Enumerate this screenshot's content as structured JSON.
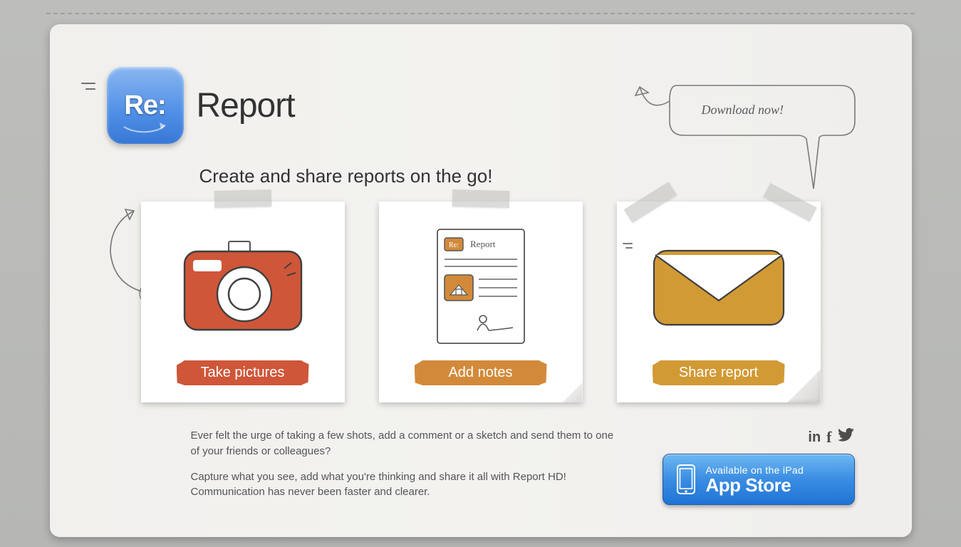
{
  "brand": {
    "icon_text": "Re:",
    "title": "Report"
  },
  "tagline": "Create and share reports on the go!",
  "download_callout": "Download now!",
  "cards": [
    {
      "label": "Take pictures"
    },
    {
      "label": "Add notes",
      "doc_title": "Report",
      "doc_badge": "Re:"
    },
    {
      "label": "Share report"
    }
  ],
  "blurb": {
    "p1": "Ever felt the urge of taking a few shots, add a comment or a sketch and send them to one of your friends or colleagues?",
    "p2": "Capture what you see, add what you're thinking and share it all with Report HD! Communication has never been faster and clearer."
  },
  "social": {
    "linkedin": "in",
    "facebook": "f",
    "twitter": "twitter"
  },
  "appstore": {
    "line1": "Available on the iPad",
    "line2": "App Store"
  }
}
